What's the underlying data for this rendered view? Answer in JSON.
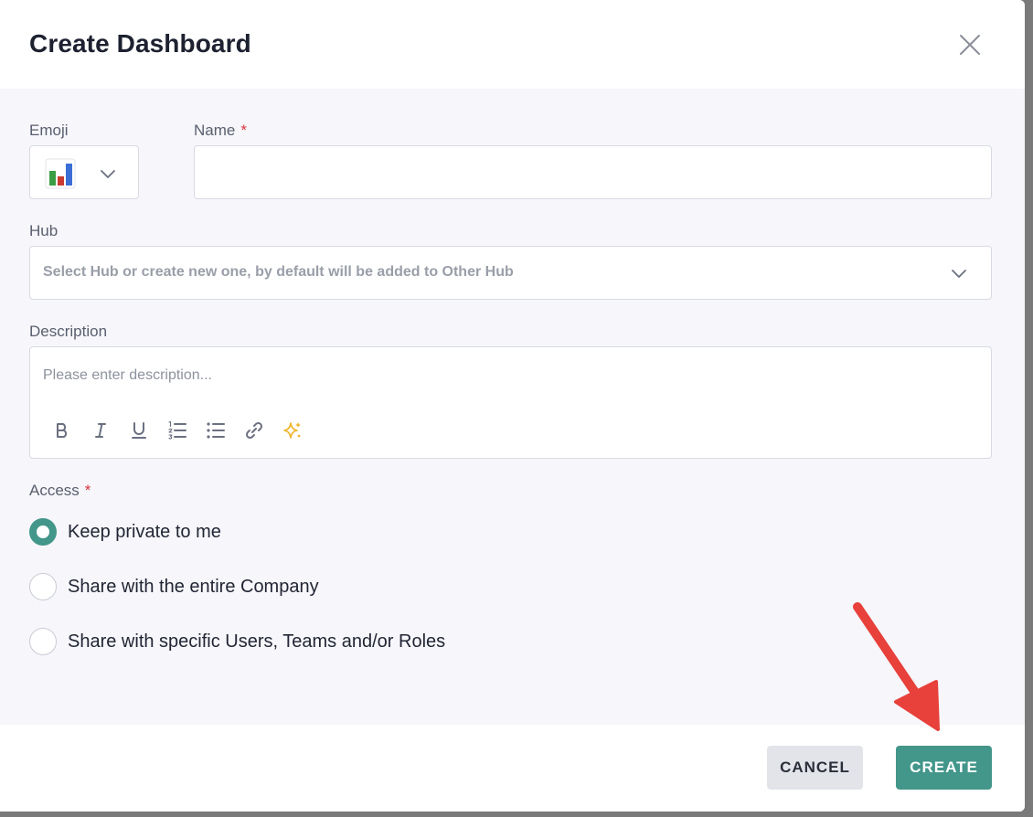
{
  "dialog": {
    "title": "Create Dashboard"
  },
  "form": {
    "emoji_label": "Emoji",
    "emoji_value": "bar-chart-emoji",
    "name_label": "Name",
    "name_required_mark": "*",
    "name_value": "",
    "hub_label": "Hub",
    "hub_placeholder": "Select Hub or create new one, by default will be added to Other Hub",
    "description_label": "Description",
    "description_placeholder": "Please enter description...",
    "toolbar": [
      "bold",
      "italic",
      "underline",
      "ordered-list",
      "bullet-list",
      "link",
      "ai-sparkle"
    ],
    "access_label": "Access",
    "access_required_mark": "*",
    "access_options": [
      {
        "label": "Keep private to me",
        "selected": true
      },
      {
        "label": "Share with the entire Company",
        "selected": false
      },
      {
        "label": "Share with specific Users, Teams and/or Roles",
        "selected": false
      }
    ]
  },
  "footer": {
    "cancel_label": "CANCEL",
    "create_label": "CREATE"
  },
  "colors": {
    "accent": "#43968a",
    "required": "#d9363e",
    "annotation_arrow": "#e8403a",
    "sparkle": "#f0b429"
  }
}
